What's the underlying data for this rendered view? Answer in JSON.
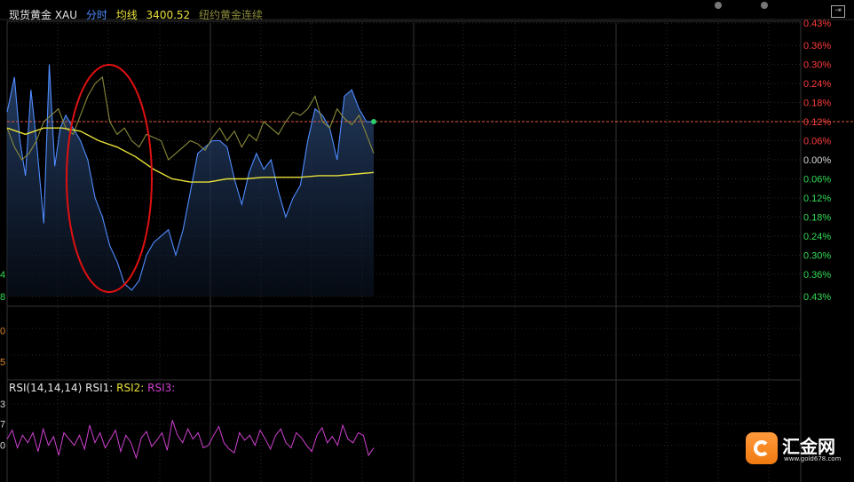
{
  "header": {
    "name": "现货黄金 XAU",
    "mode": "分时",
    "avg_label": "均线",
    "avg_value": "3400.52",
    "compare": "纽约黄金连续"
  },
  "rsi_header": {
    "label": "RSI(14,14,14)",
    "rsi1": "RSI1:",
    "rsi2": "RSI2:",
    "rsi3": "RSI3:"
  },
  "logo": {
    "name": "汇金网",
    "url": "www.gold678.com"
  },
  "chart_data": {
    "type": "line",
    "y_ticks_right": [
      {
        "label": "0.43%",
        "value": 0.43,
        "color": "#ff3b3b"
      },
      {
        "label": "0.36%",
        "value": 0.36,
        "color": "#ff3b3b"
      },
      {
        "label": "0.30%",
        "value": 0.3,
        "color": "#ff3b3b"
      },
      {
        "label": "0.24%",
        "value": 0.24,
        "color": "#ff3b3b"
      },
      {
        "label": "0.18%",
        "value": 0.18,
        "color": "#ff3b3b"
      },
      {
        "label": "0.12%",
        "value": 0.12,
        "color": "#ff3b3b"
      },
      {
        "label": "0.06%",
        "value": 0.06,
        "color": "#ff3b3b"
      },
      {
        "label": "0.00%",
        "value": 0.0,
        "color": "#d8d8d8"
      },
      {
        "label": "0.06%",
        "value": -0.06,
        "color": "#33dd55"
      },
      {
        "label": "0.12%",
        "value": -0.12,
        "color": "#33dd55"
      },
      {
        "label": "0.18%",
        "value": -0.18,
        "color": "#33dd55"
      },
      {
        "label": "0.24%",
        "value": -0.24,
        "color": "#33dd55"
      },
      {
        "label": "0.30%",
        "value": -0.3,
        "color": "#33dd55"
      },
      {
        "label": "0.36%",
        "value": -0.36,
        "color": "#33dd55"
      },
      {
        "label": "0.43%",
        "value": -0.43,
        "color": "#33dd55"
      }
    ],
    "ylim": [
      -0.43,
      0.43
    ],
    "xlim": [
      0,
      1
    ],
    "reference_line": 0.12,
    "left_axis_fragments": [
      {
        "label": "4",
        "color": "#33dd55",
        "value": -0.36
      },
      {
        "label": "8",
        "color": "#33dd55",
        "value": -0.43
      }
    ],
    "vol_axis_fragments": [
      {
        "label": "0",
        "color": "#e08a30",
        "level": 0.25
      },
      {
        "label": "5",
        "color": "#e08a30",
        "level": 0.75
      }
    ],
    "rsi_axis_fragments": [
      {
        "label": "3",
        "color": "#d8d8d8",
        "value": 83
      },
      {
        "label": "7",
        "color": "#d8d8d8",
        "value": 67
      },
      {
        "label": "0",
        "color": "#d8d8d8",
        "value": 50
      }
    ],
    "rsi_ylim": [
      30,
      90
    ],
    "series": [
      {
        "color": "#4f8cff",
        "x": [
          0,
          0.02,
          0.035,
          0.05,
          0.065,
          0.08,
          0.1,
          0.115,
          0.13,
          0.145,
          0.16,
          0.18,
          0.2,
          0.22,
          0.24,
          0.26,
          0.28,
          0.3,
          0.32,
          0.34,
          0.36,
          0.38,
          0.4,
          0.42,
          0.44,
          0.46,
          0.48,
          0.5,
          0.52,
          0.54,
          0.56,
          0.58,
          0.6,
          0.62,
          0.64,
          0.66,
          0.68,
          0.7,
          0.72,
          0.74,
          0.76,
          0.78,
          0.8,
          0.82,
          0.84,
          0.86,
          0.88,
          0.9,
          0.92,
          0.94,
          0.96,
          0.98,
          1.0
        ],
        "values": [
          0.15,
          0.26,
          0.06,
          -0.05,
          0.22,
          0.06,
          -0.2,
          0.3,
          -0.02,
          0.1,
          0.14,
          0.1,
          0.06,
          0.0,
          -0.12,
          -0.18,
          -0.27,
          -0.32,
          -0.39,
          -0.41,
          -0.38,
          -0.3,
          -0.26,
          -0.24,
          -0.22,
          -0.3,
          -0.22,
          -0.1,
          0.02,
          0.04,
          0.06,
          0.06,
          0.04,
          -0.06,
          -0.14,
          -0.04,
          0.02,
          -0.03,
          0.0,
          -0.1,
          -0.18,
          -0.12,
          -0.08,
          0.06,
          0.16,
          0.14,
          0.1,
          0.0,
          0.2,
          0.22,
          0.16,
          0.12,
          0.12
        ]
      },
      {
        "color": "#8a8a3a",
        "x": [
          0,
          0.02,
          0.04,
          0.06,
          0.08,
          0.1,
          0.12,
          0.14,
          0.16,
          0.18,
          0.2,
          0.22,
          0.24,
          0.26,
          0.28,
          0.3,
          0.32,
          0.34,
          0.36,
          0.38,
          0.4,
          0.42,
          0.44,
          0.46,
          0.48,
          0.5,
          0.52,
          0.54,
          0.56,
          0.58,
          0.6,
          0.62,
          0.64,
          0.66,
          0.68,
          0.7,
          0.72,
          0.74,
          0.76,
          0.78,
          0.8,
          0.82,
          0.84,
          0.86,
          0.88,
          0.9,
          0.92,
          0.94,
          0.96,
          0.98,
          1.0
        ],
        "values": [
          0.1,
          0.04,
          0.0,
          0.02,
          0.06,
          0.12,
          0.14,
          0.16,
          0.1,
          0.08,
          0.14,
          0.2,
          0.24,
          0.26,
          0.12,
          0.08,
          0.1,
          0.06,
          0.04,
          0.08,
          0.07,
          0.06,
          0.0,
          0.02,
          0.04,
          0.06,
          0.05,
          0.03,
          0.07,
          0.1,
          0.06,
          0.09,
          0.04,
          0.08,
          0.06,
          0.12,
          0.1,
          0.08,
          0.12,
          0.15,
          0.14,
          0.16,
          0.2,
          0.12,
          0.1,
          0.16,
          0.13,
          0.11,
          0.14,
          0.08,
          0.02
        ]
      },
      {
        "color": "#e8e03a",
        "x": [
          0,
          0.05,
          0.1,
          0.15,
          0.2,
          0.25,
          0.3,
          0.35,
          0.4,
          0.45,
          0.5,
          0.55,
          0.6,
          0.65,
          0.7,
          0.75,
          0.8,
          0.85,
          0.9,
          0.95,
          1.0
        ],
        "values": [
          0.1,
          0.08,
          0.1,
          0.1,
          0.09,
          0.06,
          0.04,
          0.01,
          -0.03,
          -0.06,
          -0.07,
          -0.07,
          -0.06,
          -0.06,
          -0.055,
          -0.055,
          -0.055,
          -0.05,
          -0.05,
          -0.045,
          -0.04
        ]
      }
    ],
    "rsi_series": {
      "color": "#d040d0",
      "values": [
        55,
        62,
        48,
        58,
        52,
        60,
        45,
        63,
        50,
        57,
        42,
        60,
        55,
        50,
        58,
        47,
        66,
        52,
        60,
        48,
        55,
        62,
        45,
        58,
        52,
        40,
        56,
        61,
        49,
        54,
        60,
        46,
        70,
        58,
        52,
        63,
        55,
        60,
        48,
        50,
        58,
        65,
        52,
        47,
        44,
        60,
        54,
        58,
        50,
        62,
        55,
        47,
        58,
        63,
        52,
        48,
        60,
        56,
        50,
        45,
        58,
        64,
        52,
        57,
        50,
        66,
        55,
        52,
        60,
        58,
        42,
        48
      ]
    }
  }
}
